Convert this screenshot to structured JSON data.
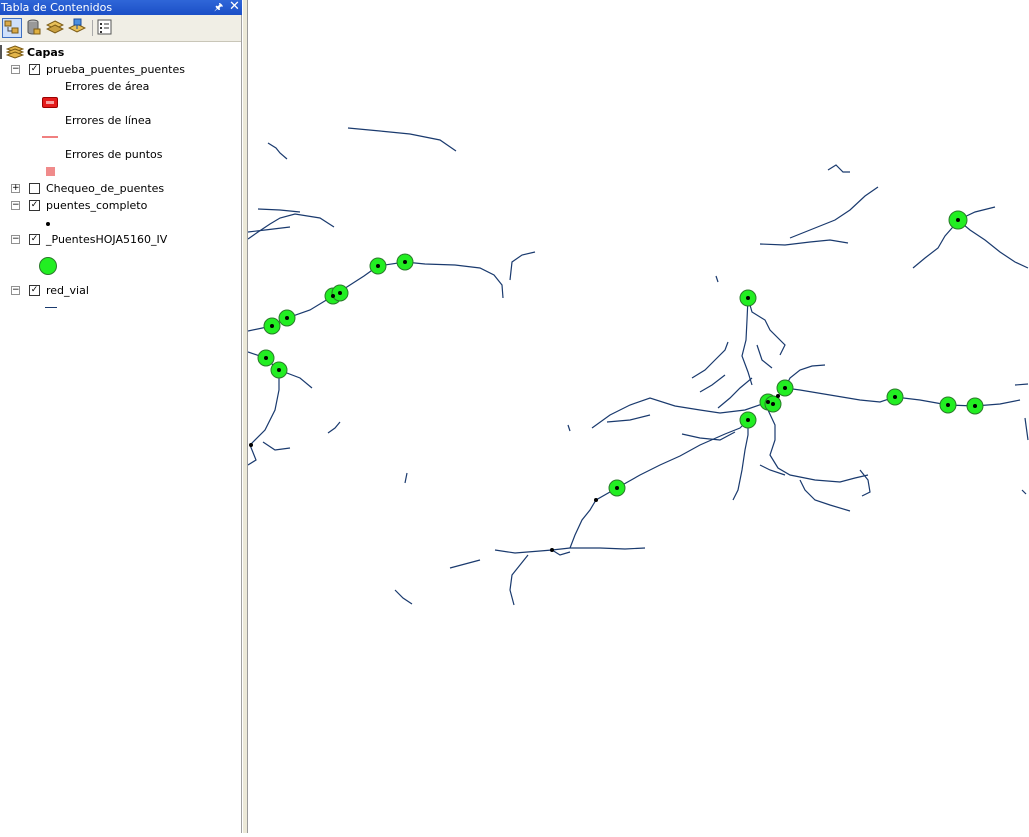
{
  "toc": {
    "title": "Tabla de Contenidos",
    "pin_glyph": "🖈",
    "close_glyph": "✕",
    "toolbar": [
      {
        "icon": "list-by-drawing-order-icon",
        "active": true
      },
      {
        "icon": "list-by-source-icon",
        "active": false
      },
      {
        "icon": "list-by-visibility-icon",
        "active": false
      },
      {
        "icon": "list-by-selection-icon",
        "active": false
      },
      {
        "icon": "options-icon",
        "active": false
      }
    ],
    "root": {
      "label": "Capas",
      "icon": "layers-icon"
    },
    "layers": [
      {
        "name": "prueba_puentes_puentes",
        "checked": true,
        "expanded": true,
        "legend": [
          {
            "label": "Errores de área",
            "symbol": "red-polygon"
          },
          {
            "label": "Errores de línea",
            "symbol": "pink-line"
          },
          {
            "label": "Errores de puntos",
            "symbol": "pink-square"
          }
        ]
      },
      {
        "name": "Chequeo_de_puentes",
        "checked": false,
        "expanded": false
      },
      {
        "name": "puentes_completo",
        "checked": true,
        "expanded": true,
        "symbol": "black-dot"
      },
      {
        "name": "_PuentesHOJA5160_IV",
        "checked": true,
        "expanded": true,
        "symbol": "green-circle"
      },
      {
        "name": "red_vial",
        "checked": true,
        "expanded": true,
        "symbol": "blue-line"
      }
    ]
  },
  "colors": {
    "title_bar": "#2053cf",
    "road": "#1a3a6e",
    "bridge_fill": "#22ee22",
    "area_error": "#e41c1c",
    "line_error": "#f08080",
    "point_error": "#f08b8b"
  }
}
